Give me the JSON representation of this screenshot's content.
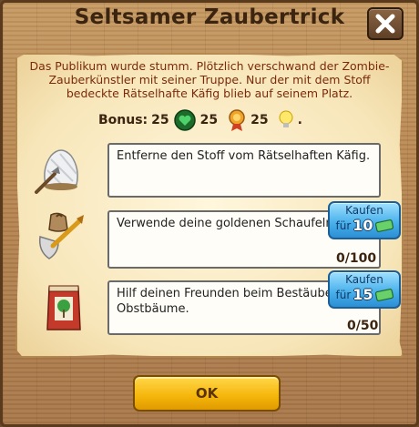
{
  "dialog": {
    "title": "Seltsamer Zaubertrick",
    "close_icon": "close-x-icon",
    "intro": "Das Publikum wurde stumm. Plötzlich verschwand der Zombie-Zauberkünstler mit seiner Truppe. Nur der mit dem Stoff bedeckte Rätselhafte Käfig blieb auf seinem Platz.",
    "bonus": {
      "label": "Bonus:",
      "coins": "25",
      "xp": "25",
      "medal": "25",
      "idea_suffix": ".",
      "icons": [
        "coin-heart-icon",
        "medal-icon",
        "lightbulb-icon"
      ]
    },
    "tasks": [
      {
        "icon": "covered-cage-icon",
        "text": "Entferne den Stoff vom Rätselhaften Käfig."
      },
      {
        "icon": "golden-shovel-icon",
        "text": "Verwende deine goldenen Schaufeln.",
        "progress": "0/100",
        "buy": {
          "label": "Kaufen",
          "for": "für",
          "price": "10",
          "currency_icon": "cash-icon"
        }
      },
      {
        "icon": "seed-bag-icon",
        "text": "Hilf deinen Freunden beim Bestäuben ihrer Obstbäume.",
        "progress": "0/50",
        "buy": {
          "label": "Kaufen",
          "for": "für",
          "price": "15",
          "currency_icon": "cash-icon"
        }
      }
    ],
    "ok_label": "OK"
  },
  "colors": {
    "wood": "#b98852",
    "parchment": "#f7e6b9",
    "intro_text": "#7a2a0a",
    "buy_button": "#4bb2ec",
    "ok_button": "#f5b50a"
  }
}
